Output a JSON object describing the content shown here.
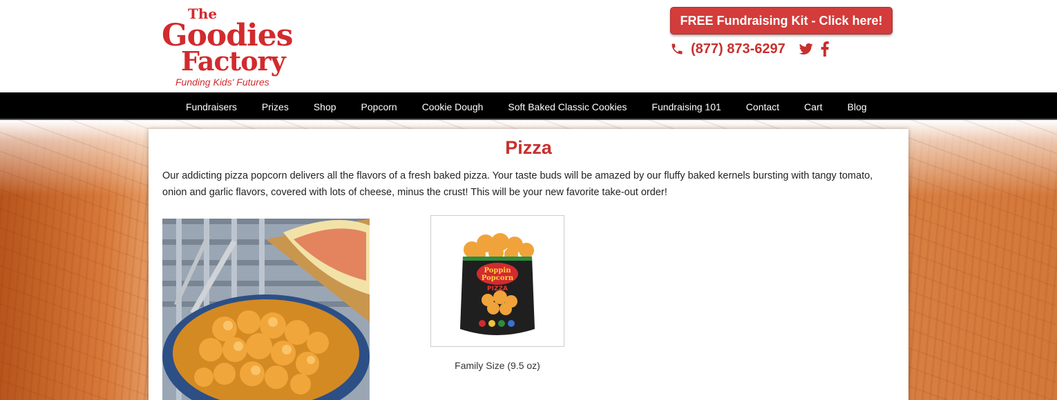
{
  "header": {
    "logo": {
      "the": "The",
      "goodies": "Goodies",
      "factory": "Factory",
      "tagline": "Funding Kids' Futures"
    },
    "kit_button": "FREE Fundraising Kit - Click here!",
    "phone": "(877) 873-6297",
    "icons": [
      "phone-icon",
      "twitter-icon",
      "facebook-icon"
    ]
  },
  "nav": {
    "items": [
      {
        "label": "Fundraisers"
      },
      {
        "label": "Prizes"
      },
      {
        "label": "Shop"
      },
      {
        "label": "Popcorn"
      },
      {
        "label": "Cookie Dough"
      },
      {
        "label": "Soft Baked Classic Cookies"
      },
      {
        "label": "Fundraising 101"
      },
      {
        "label": "Contact"
      },
      {
        "label": "Cart"
      },
      {
        "label": "Blog"
      }
    ]
  },
  "main": {
    "title": "Pizza",
    "description": "Our addicting pizza popcorn delivers all the flavors of a fresh baked pizza. Your taste buds will be amazed by our fluffy baked kernels bursting with tangy tomato, onion and garlic flavors, covered with lots of cheese, minus the crust! This will be your new favorite take-out order!",
    "product": {
      "bag_brand": "Poppin Popcorn",
      "bag_flavor": "PIZZA",
      "caption": "Family Size (9.5 oz)"
    }
  },
  "colors": {
    "brand_red": "#c7302d",
    "button_red": "#d33c3a",
    "nav_bg": "#000000"
  }
}
